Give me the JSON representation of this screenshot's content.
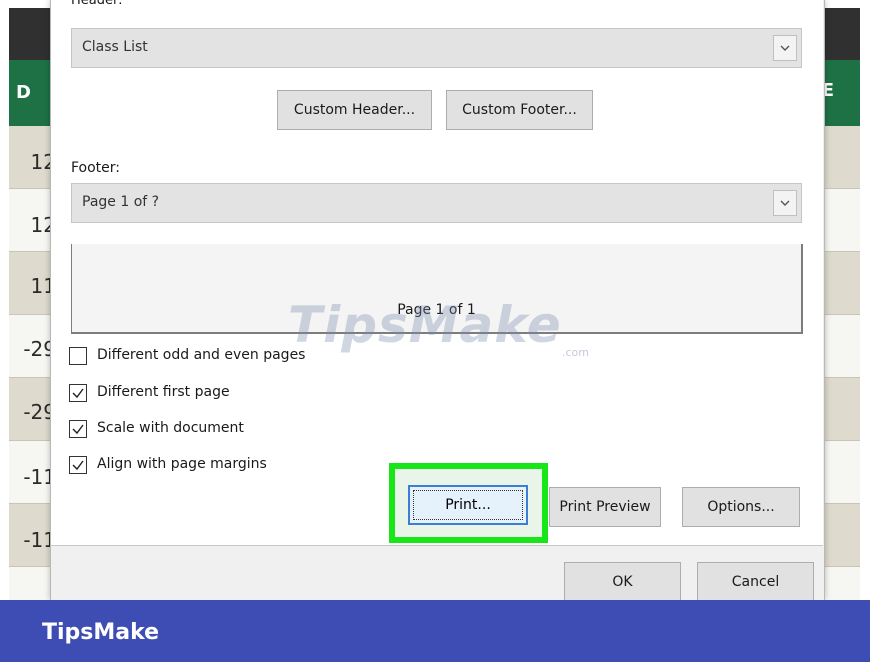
{
  "sheet": {
    "rows": [
      {
        "left_text": "12"
      },
      {
        "left_text": "12"
      },
      {
        "left_text": "11"
      },
      {
        "left_text": "-29"
      },
      {
        "left_text": "-29"
      },
      {
        "left_text": "-11"
      },
      {
        "left_text": "-11"
      }
    ],
    "header_left_letter": "D",
    "header_right_letter": "E"
  },
  "dialog": {
    "header_label": "Header:",
    "header_value": "Class List",
    "custom_header_label": "Custom Header...",
    "custom_footer_label": "Custom Footer...",
    "footer_label": "Footer:",
    "footer_value": "Page 1 of ?",
    "preview_text": "Page 1 of 1",
    "checkboxes": [
      {
        "label": "Different odd and even pages",
        "checked": false
      },
      {
        "label": "Different first page",
        "checked": true
      },
      {
        "label": "Scale with document",
        "checked": true
      },
      {
        "label": "Align with page margins",
        "checked": true
      }
    ],
    "print_label": "Print...",
    "print_preview_label": "Print Preview",
    "options_label": "Options...",
    "ok_label": "OK",
    "cancel_label": "Cancel"
  },
  "highlight_color": "#19e619",
  "watermark": {
    "text": "TipsMake",
    "suffix": ".com"
  },
  "brand": {
    "text": "TipsMake",
    "bar_color": "#3d4db3"
  }
}
